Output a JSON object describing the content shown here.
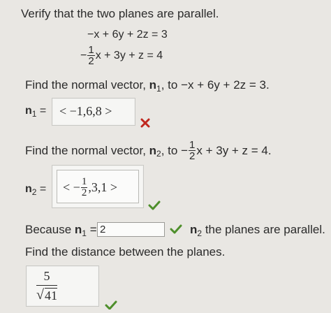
{
  "problem": {
    "instruction": "Verify that the two planes are parallel.",
    "plane1": "−x + 6y + 2z = 3",
    "plane2_prefix": "−",
    "plane2_frac_num": "1",
    "plane2_frac_den": "2",
    "plane2_rest": "x + 3y + z = 4"
  },
  "part1": {
    "prompt": "Find the normal vector,",
    "vector_label": "n",
    "vector_sub": "1",
    "prompt_to": ", to −x + 6y + 2z = 3.",
    "answer": "< −1,6,8 >",
    "status": "incorrect"
  },
  "part2": {
    "prompt": "Find the normal vector,",
    "vector_label": "n",
    "vector_sub": "2",
    "prompt_to_prefix": ", to −",
    "frac_num": "1",
    "frac_den": "2",
    "prompt_to_rest": "x + 3y + z = 4.",
    "answer_prefix": "< −",
    "answer_frac_num": "1",
    "answer_frac_den": "2",
    "answer_rest": ",3,1 >",
    "status": "correct"
  },
  "part3": {
    "prefix": "Because",
    "n1_label": "n",
    "n1_sub": "1",
    "eq": "=",
    "answer": "2",
    "n2_label": "n",
    "n2_sub": "2",
    "suffix": "the planes are parallel.",
    "status": "correct"
  },
  "part4": {
    "prompt": "Find the distance between the planes.",
    "answer_num": "5",
    "answer_den": "41",
    "status": "correct"
  },
  "colors": {
    "check": "#4e8f2b",
    "cross": "#c0271e"
  }
}
